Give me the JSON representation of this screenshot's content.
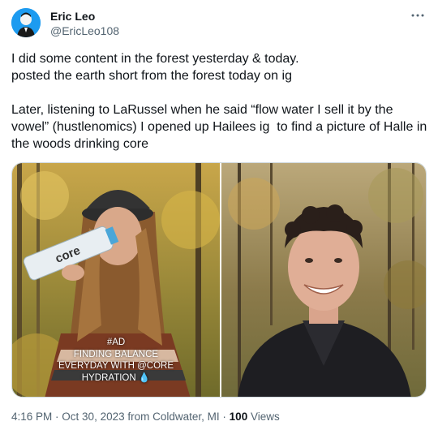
{
  "author": {
    "name": "Eric Leo",
    "handle": "@EricLeo108",
    "avatar_icon": "profile-avatar"
  },
  "more_icon": "more-dots-icon",
  "tweet_text": {
    "line1": "I did some content in the forest yesterday & today.",
    "line2": "posted the earth short from the forest today on ig",
    "line3": "Later, listening to LaRussel when he said “flow water I sell it by the",
    "line4": "vowel” (hustlenomics) I opened up Hailees ig  to find a picture of Halle in",
    "line5": "the woods drinking core"
  },
  "media": {
    "left_overlay": {
      "line1": "#AD",
      "line2": "FINDING BALANCE",
      "line3": "EVERYDAY WITH @CORE",
      "line4": "HYDRATION 💧"
    },
    "bottle_label": "core"
  },
  "meta": {
    "time": "4:16 PM",
    "date": "Oct 30, 2023",
    "location": "from Coldwater, MI",
    "views_count": "100",
    "views_label": "Views"
  },
  "colors": {
    "text": "#0f1419",
    "secondary": "#536471",
    "accent": "#1d9bf0",
    "border": "#cfd9de"
  }
}
